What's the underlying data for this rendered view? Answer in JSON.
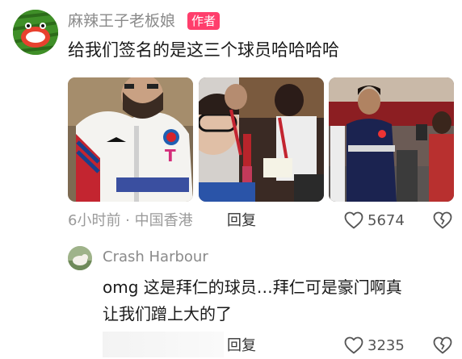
{
  "comment": {
    "author": "麻辣王子老板娘",
    "badge": "作者",
    "text": "给我们签名的是这三个球员哈哈哈哈",
    "meta": "6小时前 · 中国香港",
    "reply_label": "回复",
    "like_count": "5674"
  },
  "reply": {
    "author": "Crash Harbour",
    "line1": "omg 这是拜仁的球员…拜仁可是豪门啊真",
    "line2": "让我们蹭上大的了",
    "reply_label": "回复",
    "like_count": "3235"
  },
  "colors": {
    "badge": "#ff3e6c",
    "muted_text": "#8a8a8a",
    "main_text": "#1a1a1a"
  },
  "icons": {
    "like": "heart-outline-icon",
    "dislike": "broken-heart-outline-icon"
  }
}
